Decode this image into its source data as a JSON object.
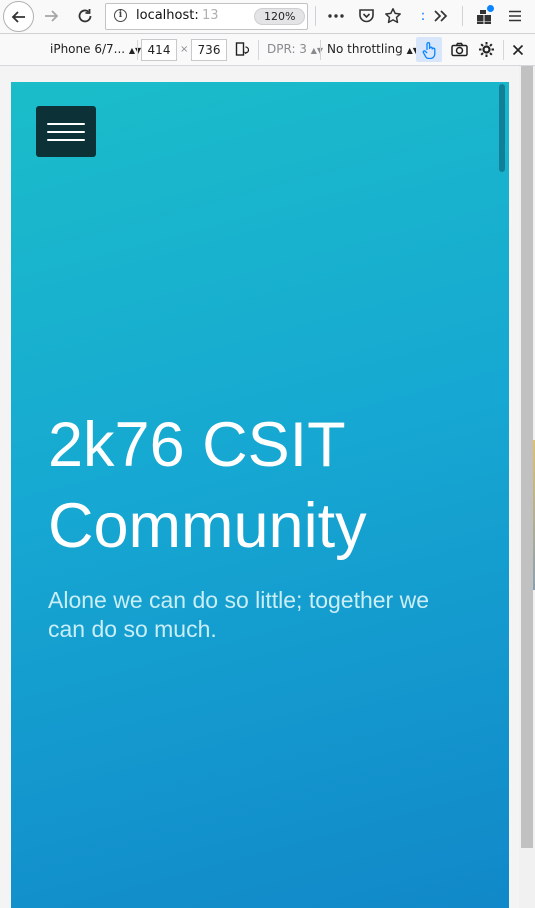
{
  "browser": {
    "url_host": "localhost:",
    "url_port": "13",
    "zoom": "120%",
    "icons": {
      "back": "back-arrow-icon",
      "forward": "forward-arrow-icon",
      "reload": "reload-icon",
      "info": "site-info-icon",
      "page_actions": "more-actions-icon",
      "pocket": "pocket-icon",
      "bookmark": "bookmark-star-icon",
      "overflow": "overflow-chevrons-icon",
      "extensions": "extensions-icon",
      "menu": "hamburger-menu-icon"
    },
    "accent_color": "#0a84ff"
  },
  "responsive_toolbar": {
    "device": "iPhone 6/7...",
    "width": "414",
    "times": "×",
    "height": "736",
    "dpr": "DPR: 3",
    "throttling": "No throttling",
    "touch_simulation_enabled": true
  },
  "page": {
    "title_line_1": "2k76 CSIT",
    "title_line_2": "Community",
    "subtitle": "Alone we can do so little; together we can do so much.",
    "gradient_start": "#1bbdc9",
    "gradient_end": "#1188c9",
    "menu_button_color": "#0c3136"
  }
}
